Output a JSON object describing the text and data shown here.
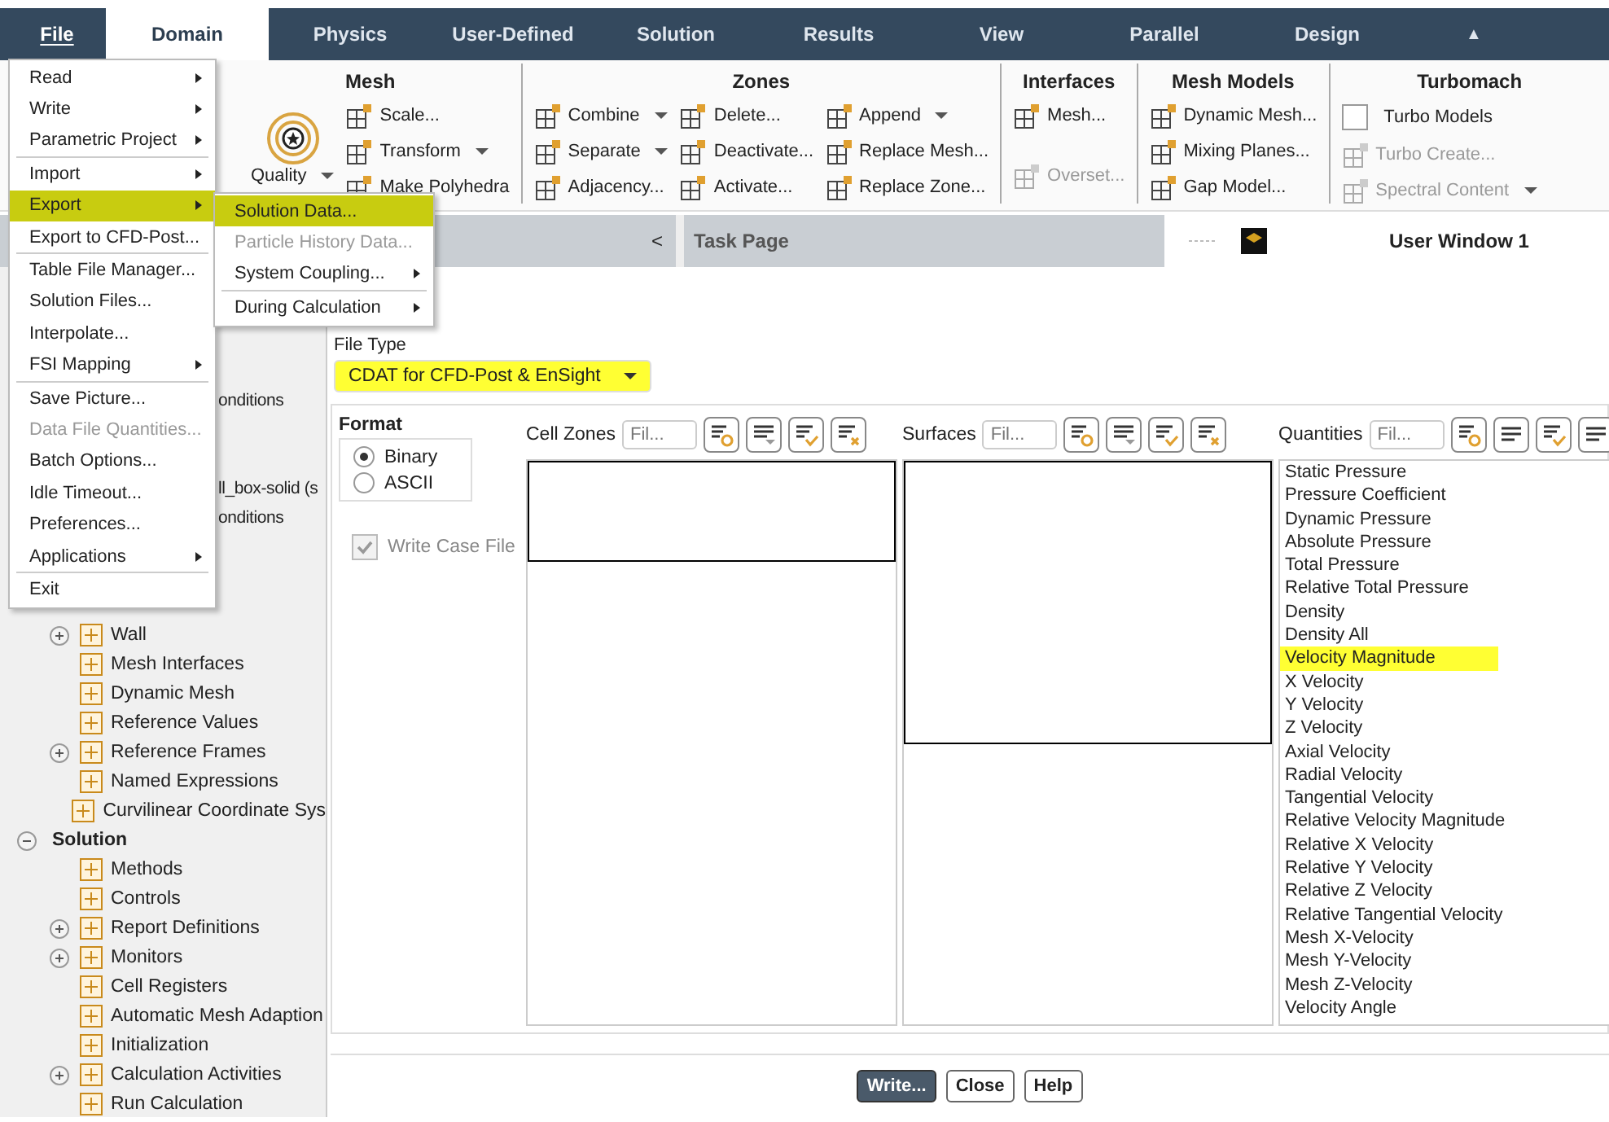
{
  "tabs": [
    {
      "label": "File",
      "selected": false,
      "kind": "file"
    },
    {
      "label": "Domain",
      "selected": true,
      "kind": "tab"
    },
    {
      "label": "Physics",
      "selected": false,
      "kind": "tab"
    },
    {
      "label": "User-Defined",
      "selected": false,
      "kind": "tab"
    },
    {
      "label": "Solution",
      "selected": false,
      "kind": "tab"
    },
    {
      "label": "Results",
      "selected": false,
      "kind": "tab"
    },
    {
      "label": "View",
      "selected": false,
      "kind": "tab"
    },
    {
      "label": "Parallel",
      "selected": false,
      "kind": "tab"
    },
    {
      "label": "Design",
      "selected": false,
      "kind": "tab"
    },
    {
      "label": "▲",
      "selected": false,
      "kind": "collapse"
    }
  ],
  "ribbon": [
    {
      "title": "Mesh",
      "columns": [
        [
          {
            "label": "Quality",
            "kind": "large",
            "dropdown": true,
            "disabled": false
          }
        ],
        [
          {
            "label": "Scale...",
            "kind": "button",
            "dropdown": false,
            "disabled": false
          },
          {
            "label": "Transform",
            "kind": "button",
            "dropdown": true,
            "disabled": false
          },
          {
            "label": "Make Polyhedra",
            "kind": "button",
            "dropdown": false,
            "disabled": false
          }
        ]
      ]
    },
    {
      "title": "Zones",
      "columns": [
        [
          {
            "label": "Combine",
            "kind": "button",
            "dropdown": true,
            "disabled": false
          },
          {
            "label": "Separate",
            "kind": "button",
            "dropdown": true,
            "disabled": false
          },
          {
            "label": "Adjacency...",
            "kind": "button",
            "dropdown": false,
            "disabled": false
          }
        ],
        [
          {
            "label": "Delete...",
            "kind": "button",
            "dropdown": false,
            "disabled": false
          },
          {
            "label": "Deactivate...",
            "kind": "button",
            "dropdown": false,
            "disabled": false
          },
          {
            "label": "Activate...",
            "kind": "button",
            "dropdown": false,
            "disabled": false
          }
        ],
        [
          {
            "label": "Append",
            "kind": "button",
            "dropdown": true,
            "disabled": false
          },
          {
            "label": "Replace Mesh...",
            "kind": "button",
            "dropdown": false,
            "disabled": false
          },
          {
            "label": "Replace Zone...",
            "kind": "button",
            "dropdown": false,
            "disabled": false
          }
        ]
      ]
    },
    {
      "title": "Interfaces",
      "columns": [
        [
          {
            "label": "Mesh...",
            "kind": "button",
            "dropdown": false,
            "disabled": false
          },
          {
            "label": "Overset...",
            "kind": "button",
            "dropdown": false,
            "disabled": true
          }
        ]
      ]
    },
    {
      "title": "Mesh Models",
      "columns": [
        [
          {
            "label": "Dynamic Mesh...",
            "kind": "button",
            "dropdown": false,
            "disabled": false
          },
          {
            "label": "Mixing Planes...",
            "kind": "button",
            "dropdown": false,
            "disabled": false
          },
          {
            "label": "Gap Model...",
            "kind": "button",
            "dropdown": false,
            "disabled": false
          }
        ]
      ]
    },
    {
      "title": "Turbomach",
      "columns": [
        [
          {
            "label": "Turbo Models",
            "kind": "checkbox",
            "checked": false,
            "dropdown": false,
            "disabled": false
          },
          {
            "label": "Turbo Create...",
            "kind": "button",
            "dropdown": false,
            "disabled": true
          },
          {
            "label": "Spectral Content",
            "kind": "button",
            "dropdown": true,
            "disabled": true
          }
        ]
      ]
    }
  ],
  "panel_header": {
    "collapse": "<",
    "title": "Task Page"
  },
  "graphics_header": {
    "title": "User Window 1"
  },
  "file_menu": [
    {
      "kind": "item",
      "label": "Read",
      "submenu": true,
      "disabled": false,
      "highlighted": false
    },
    {
      "kind": "item",
      "label": "Write",
      "submenu": true,
      "disabled": false,
      "highlighted": false
    },
    {
      "kind": "item",
      "label": "Parametric Project",
      "submenu": true,
      "disabled": false,
      "highlighted": false
    },
    {
      "kind": "separator"
    },
    {
      "kind": "item",
      "label": "Import",
      "submenu": true,
      "disabled": false,
      "highlighted": false
    },
    {
      "kind": "item",
      "label": "Export",
      "submenu": true,
      "disabled": false,
      "highlighted": true
    },
    {
      "kind": "item",
      "label": "Export to CFD-Post...",
      "submenu": false,
      "disabled": false,
      "highlighted": false
    },
    {
      "kind": "separator"
    },
    {
      "kind": "item",
      "label": "Table File Manager...",
      "submenu": false,
      "disabled": false,
      "highlighted": false
    },
    {
      "kind": "item",
      "label": "Solution Files...",
      "submenu": false,
      "disabled": false,
      "highlighted": false
    },
    {
      "kind": "item",
      "label": "Interpolate...",
      "submenu": false,
      "disabled": false,
      "highlighted": false
    },
    {
      "kind": "item",
      "label": "FSI Mapping",
      "submenu": true,
      "disabled": false,
      "highlighted": false
    },
    {
      "kind": "separator"
    },
    {
      "kind": "item",
      "label": "Save Picture...",
      "submenu": false,
      "disabled": false,
      "highlighted": false
    },
    {
      "kind": "item",
      "label": "Data File Quantities...",
      "submenu": false,
      "disabled": true,
      "highlighted": false
    },
    {
      "kind": "item",
      "label": "Batch Options...",
      "submenu": false,
      "disabled": false,
      "highlighted": false
    },
    {
      "kind": "item",
      "label": "Idle Timeout...",
      "submenu": false,
      "disabled": false,
      "highlighted": false
    },
    {
      "kind": "item",
      "label": "Preferences...",
      "submenu": false,
      "disabled": false,
      "highlighted": false
    },
    {
      "kind": "item",
      "label": "Applications",
      "submenu": true,
      "disabled": false,
      "highlighted": false
    },
    {
      "kind": "separator"
    },
    {
      "kind": "item",
      "label": "Exit",
      "submenu": false,
      "disabled": false,
      "highlighted": false
    }
  ],
  "export_submenu": [
    {
      "kind": "item",
      "label": "Solution Data...",
      "submenu": false,
      "disabled": false,
      "highlighted": true
    },
    {
      "kind": "item",
      "label": "Particle History Data...",
      "submenu": false,
      "disabled": true,
      "highlighted": false
    },
    {
      "kind": "item",
      "label": "System Coupling...",
      "submenu": true,
      "disabled": false,
      "highlighted": false
    },
    {
      "kind": "separator"
    },
    {
      "kind": "item",
      "label": "During Calculation",
      "submenu": true,
      "disabled": false,
      "highlighted": false
    }
  ],
  "tree": [
    {
      "kind": "cut",
      "label": "onditions"
    },
    {
      "kind": "cut",
      "label": "ll_box-solid (s"
    },
    {
      "kind": "cut",
      "label": "onditions"
    },
    {
      "kind": "branch",
      "label": "Wall",
      "expanded": false
    },
    {
      "kind": "leaf",
      "label": "Mesh Interfaces"
    },
    {
      "kind": "leaf",
      "label": "Dynamic Mesh"
    },
    {
      "kind": "leaf",
      "label": "Reference Values"
    },
    {
      "kind": "branch",
      "label": "Reference Frames",
      "expanded": false
    },
    {
      "kind": "leaf",
      "label": "Named Expressions"
    },
    {
      "kind": "leaf",
      "label": "Curvilinear Coordinate Sys"
    },
    {
      "kind": "heading",
      "label": "Solution",
      "expanded": true
    },
    {
      "kind": "leaf",
      "label": "Methods"
    },
    {
      "kind": "leaf",
      "label": "Controls"
    },
    {
      "kind": "branch",
      "label": "Report Definitions",
      "expanded": false
    },
    {
      "kind": "branch",
      "label": "Monitors",
      "expanded": false
    },
    {
      "kind": "leaf",
      "label": "Cell Registers"
    },
    {
      "kind": "leaf",
      "label": "Automatic Mesh Adaption"
    },
    {
      "kind": "leaf",
      "label": "Initialization"
    },
    {
      "kind": "branch",
      "label": "Calculation Activities",
      "expanded": false
    },
    {
      "kind": "leaf",
      "label": "Run Calculation"
    }
  ],
  "dialog": {
    "file_type": {
      "label": "File Type",
      "value": "CDAT for CFD-Post & EnSight",
      "highlighted": true
    },
    "format": {
      "title": "Format",
      "options": [
        {
          "label": "Binary",
          "selected": true
        },
        {
          "label": "ASCII",
          "selected": false
        }
      ]
    },
    "write_case_file": {
      "label": "Write Case File",
      "checked": true,
      "disabled": true
    },
    "lists": [
      {
        "label": "Cell Zones",
        "placeholder": "Fil...",
        "tools": [
          {
            "kind": "circle"
          },
          {
            "kind": "caret"
          },
          {
            "kind": "check"
          },
          {
            "kind": "cross"
          }
        ]
      },
      {
        "label": "Surfaces",
        "placeholder": "Fil...",
        "tools": [
          {
            "kind": "circle"
          },
          {
            "kind": "caret"
          },
          {
            "kind": "check"
          },
          {
            "kind": "cross"
          }
        ]
      },
      {
        "label": "Quantities",
        "placeholder": "Fil...",
        "tools": [
          {
            "kind": "circle"
          },
          {
            "kind": "lines"
          },
          {
            "kind": "check"
          },
          {
            "kind": "lines"
          }
        ],
        "items": [
          {
            "label": "Static Pressure",
            "highlighted": false
          },
          {
            "label": "Pressure Coefficient",
            "highlighted": false
          },
          {
            "label": "Dynamic Pressure",
            "highlighted": false
          },
          {
            "label": "Absolute Pressure",
            "highlighted": false
          },
          {
            "label": "Total Pressure",
            "highlighted": false
          },
          {
            "label": "Relative Total Pressure",
            "highlighted": false
          },
          {
            "label": "Density",
            "highlighted": false
          },
          {
            "label": "Density All",
            "highlighted": false
          },
          {
            "label": "Velocity Magnitude",
            "highlighted": true
          },
          {
            "label": "X Velocity",
            "highlighted": false
          },
          {
            "label": "Y Velocity",
            "highlighted": false
          },
          {
            "label": "Z Velocity",
            "highlighted": false
          },
          {
            "label": "Axial Velocity",
            "highlighted": false
          },
          {
            "label": "Radial Velocity",
            "highlighted": false
          },
          {
            "label": "Tangential Velocity",
            "highlighted": false
          },
          {
            "label": "Relative Velocity Magnitude",
            "highlighted": false
          },
          {
            "label": "Relative X Velocity",
            "highlighted": false
          },
          {
            "label": "Relative Y Velocity",
            "highlighted": false
          },
          {
            "label": "Relative Z Velocity",
            "highlighted": false
          },
          {
            "label": "Relative Tangential Velocity",
            "highlighted": false
          },
          {
            "label": "Mesh X-Velocity",
            "highlighted": false
          },
          {
            "label": "Mesh Y-Velocity",
            "highlighted": false
          },
          {
            "label": "Mesh Z-Velocity",
            "highlighted": false
          },
          {
            "label": "Velocity Angle",
            "highlighted": false
          }
        ]
      }
    ],
    "buttons": [
      {
        "label": "Write...",
        "kind": "primary"
      },
      {
        "label": "Close",
        "kind": "normal"
      },
      {
        "label": "Help",
        "kind": "normal"
      }
    ]
  }
}
